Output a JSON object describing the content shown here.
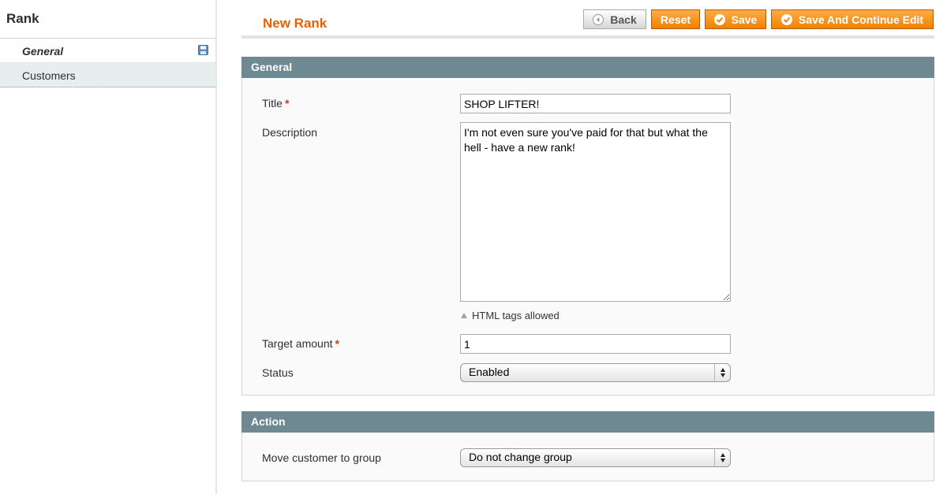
{
  "sidebar": {
    "title": "Rank",
    "tabs": [
      {
        "label": "General",
        "active": true,
        "icon": "floppy-disk-icon"
      },
      {
        "label": "Customers",
        "active": false
      }
    ]
  },
  "header": {
    "title": "New Rank",
    "buttons": {
      "back": "Back",
      "reset": "Reset",
      "save": "Save",
      "save_continue": "Save And Continue Edit"
    }
  },
  "general": {
    "heading": "General",
    "fields": {
      "title": {
        "label": "Title",
        "required": "*",
        "value": "SHOP LIFTER!"
      },
      "description": {
        "label": "Description",
        "value": "I'm not even sure you've paid for that but what the hell - have a new rank!",
        "note": "HTML tags allowed"
      },
      "target_amount": {
        "label": "Target amount",
        "required": "*",
        "value": "1"
      },
      "status": {
        "label": "Status",
        "selected": "Enabled"
      }
    }
  },
  "action": {
    "heading": "Action",
    "fields": {
      "group": {
        "label": "Move customer to group",
        "selected": "Do not change group"
      }
    }
  },
  "colors": {
    "accent": "#eb5e00",
    "button_orange": "#f18200",
    "section_header": "#6f8992",
    "required": "#eb340a"
  }
}
